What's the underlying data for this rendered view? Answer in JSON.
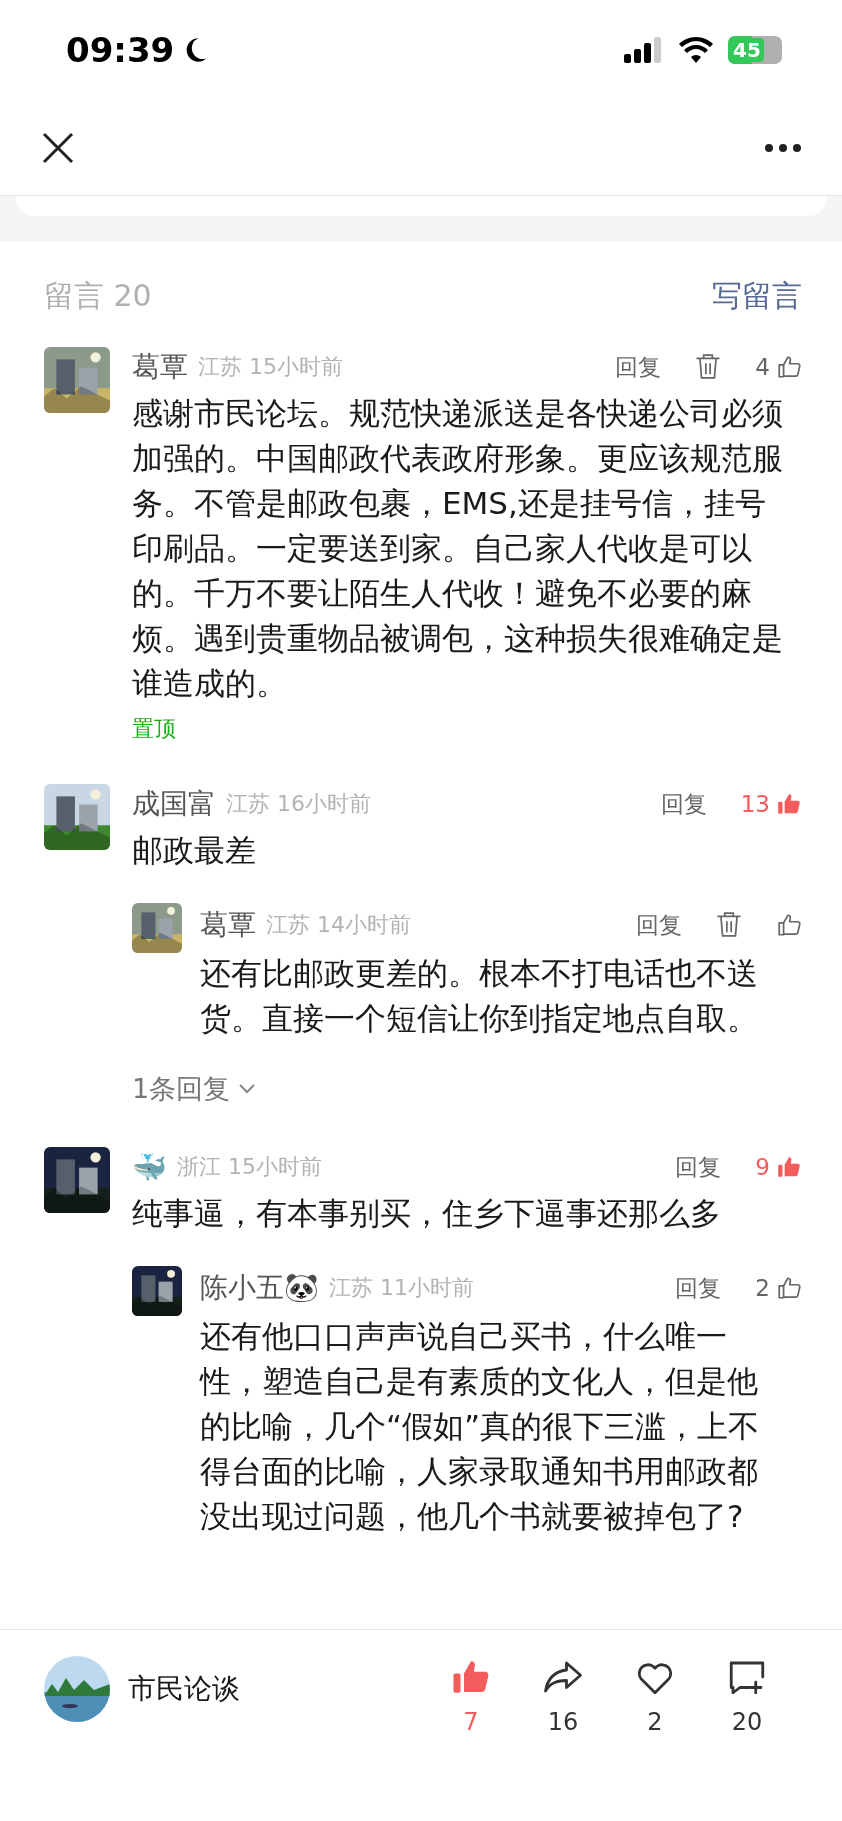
{
  "status_bar": {
    "time": "09:39",
    "battery": "45"
  },
  "comments_header": {
    "title": "留言 20",
    "write_label": "写留言"
  },
  "comments": [
    {
      "author": "葛覃",
      "region": "江苏",
      "time": "15小时前",
      "reply_label": "回复",
      "deletable": true,
      "likes": "4",
      "liked": false,
      "body": "感谢市民论坛。规范快递派送是各快递公司必须加强的。中国邮政代表政府形象。更应该规范服务。不管是邮政包裹，EMS,还是挂号信，挂号印刷品。一定要送到家。自己家人代收是可以的。千万不要让陌生人代收！避免不必要的麻烦。遇到贵重物品被调包，这种损失很难确定是谁造成的。",
      "tag": "置顶"
    },
    {
      "author": "成国富",
      "region": "江苏",
      "time": "16小时前",
      "reply_label": "回复",
      "deletable": false,
      "likes": "13",
      "liked": true,
      "body": "邮政最差",
      "replies": [
        {
          "author": "葛覃",
          "region": "江苏",
          "time": "14小时前",
          "reply_label": "回复",
          "deletable": true,
          "liked": false,
          "body": "还有比邮政更差的。根本不打电话也不送货。直接一个短信让你到指定地点自取。"
        }
      ],
      "more_replies": "1条回复"
    },
    {
      "author": "🐳",
      "region": "浙江",
      "time": "15小时前",
      "reply_label": "回复",
      "deletable": false,
      "likes": "9",
      "liked": true,
      "body": "纯事逼，有本事别买，住乡下逼事还那么多",
      "replies": [
        {
          "author": "陈小五🐼",
          "region": "江苏",
          "time": "11小时前",
          "reply_label": "回复",
          "deletable": false,
          "likes": "2",
          "liked": false,
          "body": "还有他口口声声说自己买书，什么唯一性，塑造自己是有素质的文化人，但是他的比喻，几个“假如”真的很下三滥，上不得台面的比喻，人家录取通知书用邮政都没出现过问题，他几个书就要被掉包了?"
        }
      ]
    }
  ],
  "bottom_bar": {
    "account": "市民论谈",
    "actions": [
      {
        "kind": "like",
        "count": "7",
        "selected": true
      },
      {
        "kind": "share",
        "count": "16",
        "selected": false
      },
      {
        "kind": "favorite",
        "count": "2",
        "selected": false
      },
      {
        "kind": "comment",
        "count": "20",
        "selected": false
      }
    ]
  }
}
